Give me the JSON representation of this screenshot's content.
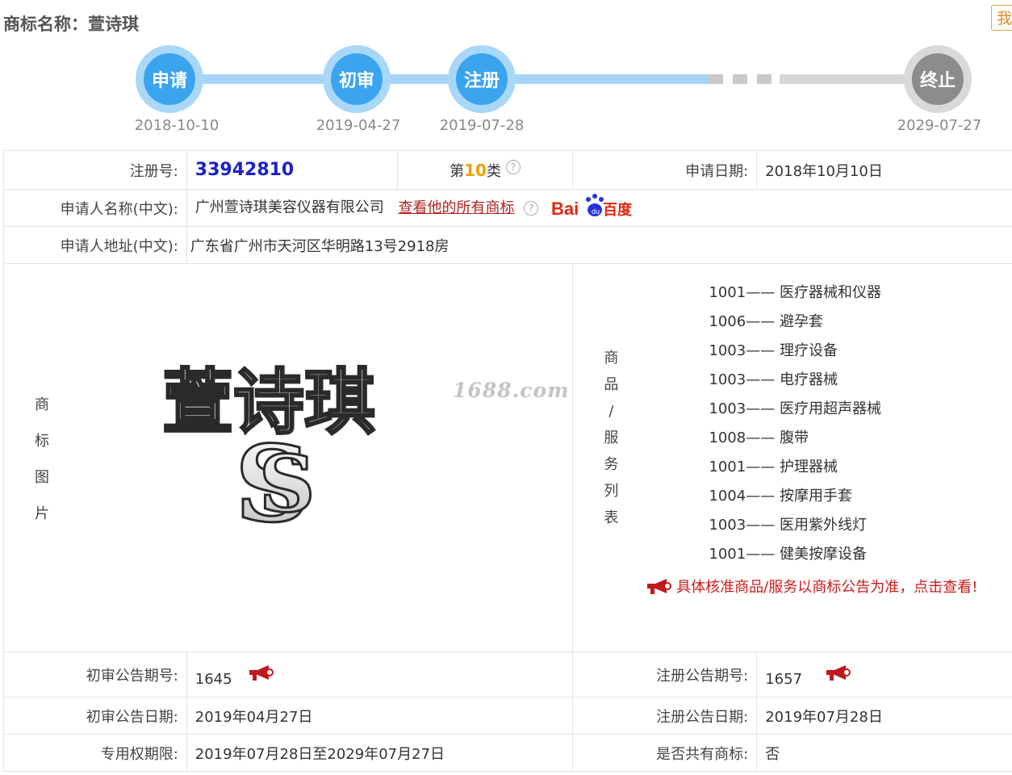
{
  "title": "商标名称：萱诗琪",
  "corner_button": "我",
  "timeline": [
    {
      "label": "申请",
      "date": "2018-10-10",
      "state": "done"
    },
    {
      "label": "初审",
      "date": "2019-04-27",
      "state": "done"
    },
    {
      "label": "注册",
      "date": "2019-07-28",
      "state": "done"
    },
    {
      "label": "终止",
      "date": "2029-07-27",
      "state": "pending"
    }
  ],
  "reg_no_label": "注册号:",
  "reg_no": "33942810",
  "class_prefix": "第",
  "class_num": "10",
  "class_suffix": "类",
  "apply_date_label": "申请日期:",
  "apply_date": "2018年10月10日",
  "applicant_label": "申请人名称(中文):",
  "applicant": "广州萱诗琪美容仪器有限公司",
  "view_all_link": "查看他的所有商标",
  "baidu_logo_text": "Bai百度",
  "address_label": "申请人地址(中文):",
  "address": "广东省广州市天河区华明路13号2918房",
  "image_label": [
    "商",
    "标",
    "图",
    "片"
  ],
  "trademark_text": "萱诗琪",
  "watermark": "1688.com",
  "goods_label": [
    "商",
    "品",
    "/",
    "服",
    "务",
    "列",
    "表"
  ],
  "goods": [
    {
      "code": "1001",
      "name": "医疗器械和仪器"
    },
    {
      "code": "1006",
      "name": "避孕套"
    },
    {
      "code": "1003",
      "name": "理疗设备"
    },
    {
      "code": "1003",
      "name": "电疗器械"
    },
    {
      "code": "1003",
      "name": "医疗用超声器械"
    },
    {
      "code": "1008",
      "name": "腹带"
    },
    {
      "code": "1001",
      "name": "护理器械"
    },
    {
      "code": "1004",
      "name": "按摩用手套"
    },
    {
      "code": "1003",
      "name": "医用紫外线灯"
    },
    {
      "code": "1001",
      "name": "健美按摩设备"
    }
  ],
  "goods_dash": "——",
  "goods_notice": "具体核准商品/服务以商标公告为准，点击查看!",
  "prelim_pub_no_label": "初审公告期号:",
  "prelim_pub_no": "1645",
  "reg_pub_no_label": "注册公告期号:",
  "reg_pub_no": "1657",
  "prelim_pub_date_label": "初审公告日期:",
  "prelim_pub_date": "2019年04月27日",
  "reg_pub_date_label": "注册公告日期:",
  "reg_pub_date": "2019年07月28日",
  "exclusive_period_label": "专用权期限:",
  "exclusive_period": "2019年07月28日至2029年07月27日",
  "shared_label": "是否共有商标:",
  "shared": "否",
  "colors": {
    "accent_blue": "#3ba4ef",
    "light_blue": "#a6d4f7",
    "grey": "#8c8c8c",
    "link_red": "#b22222",
    "orange": "#f0a000"
  }
}
